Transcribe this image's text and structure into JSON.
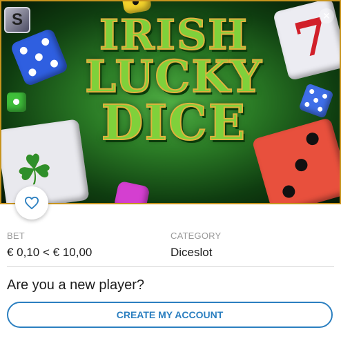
{
  "game": {
    "title_lines": [
      "IRISH",
      "LUCKY",
      "DICE"
    ],
    "brand_letter": "S",
    "close_glyph": "✕"
  },
  "details": {
    "bet_label": "BET",
    "bet_value": "€ 0,10 < € 10,00",
    "category_label": "CATEGORY",
    "category_value": "Diceslot"
  },
  "signup": {
    "question": "Are you a new player?",
    "cta_label": "CREATE MY ACCOUNT"
  },
  "icons": {
    "favorite": "heart-icon",
    "close": "close-icon"
  },
  "colors": {
    "accent": "#2b7fc0",
    "banner_green": "#2a7a25",
    "title_gold": "#e0b33c"
  }
}
